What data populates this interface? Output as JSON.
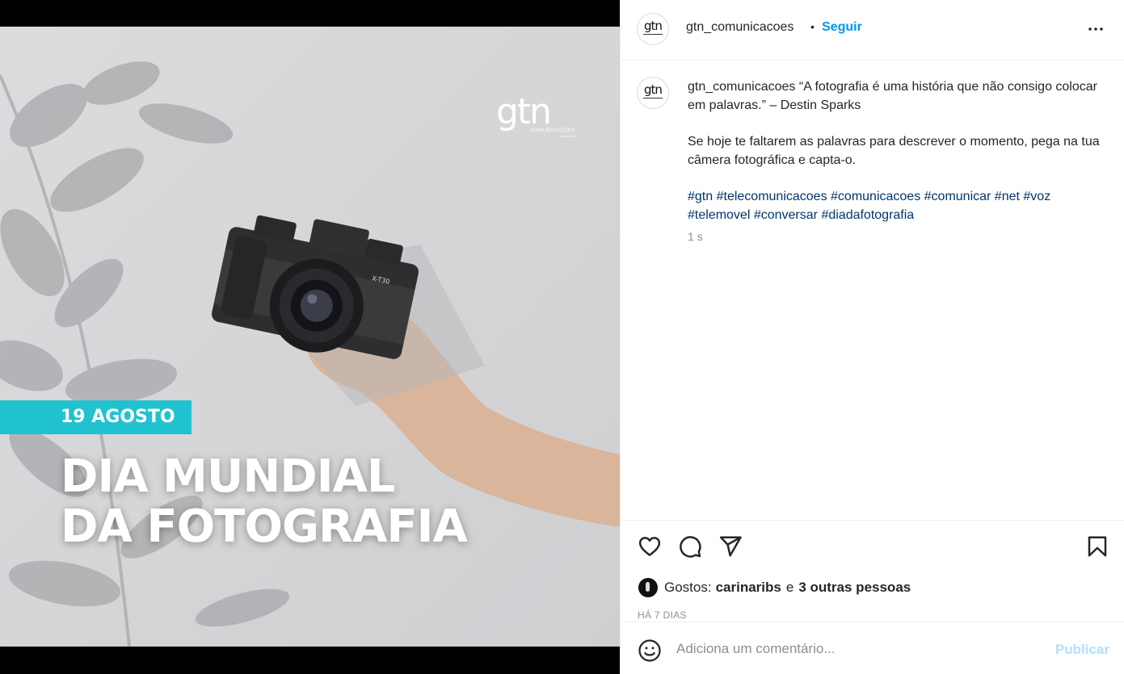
{
  "post": {
    "date_banner": "19 AGOSTO",
    "headline_line1": "DIA MUNDIAL",
    "headline_line2": "DA FOTOGRAFIA",
    "logo_mark": "gtn",
    "logo_sub": "COMUNICAÇÕES",
    "logo_since": "since 2012"
  },
  "header": {
    "avatar_text": "gtn",
    "username": "gtn_comunicacoes",
    "separator": "•",
    "follow_label": "Seguir",
    "more_icon": "more-horizontal-icon"
  },
  "caption": {
    "username": "gtn_comunicacoes",
    "quote": "“A fotografia é uma história que não consigo colocar em palavras.” – Destin Sparks",
    "body": "Se hoje te faltarem as palavras para descrever o momento, pega na tua câmera fotográfica e capta-o.",
    "hashtags": [
      "#gtn",
      "#telecomunicacoes",
      "#comunicacoes",
      "#comunicar",
      "#net",
      "#voz",
      "#telemovel",
      "#conversar",
      "#diadafotografia"
    ],
    "time": "1 s"
  },
  "actions": {
    "like_icon": "heart-icon",
    "comment_icon": "comment-icon",
    "share_icon": "send-icon",
    "save_icon": "bookmark-icon"
  },
  "likes": {
    "prefix": "Gostos:",
    "user": "carinaribs",
    "conjunction": "e",
    "others": "3 outras pessoas"
  },
  "posted_ago": "HÁ 7 DIAS",
  "comment": {
    "placeholder": "Adiciona um comentário...",
    "publish_label": "Publicar",
    "emoji_icon": "emoji-icon"
  },
  "colors": {
    "accent_banner": "#21c2cf",
    "follow_blue": "#0095f6",
    "hashtag": "#00376b",
    "publish_disabled": "#b2dffc"
  }
}
